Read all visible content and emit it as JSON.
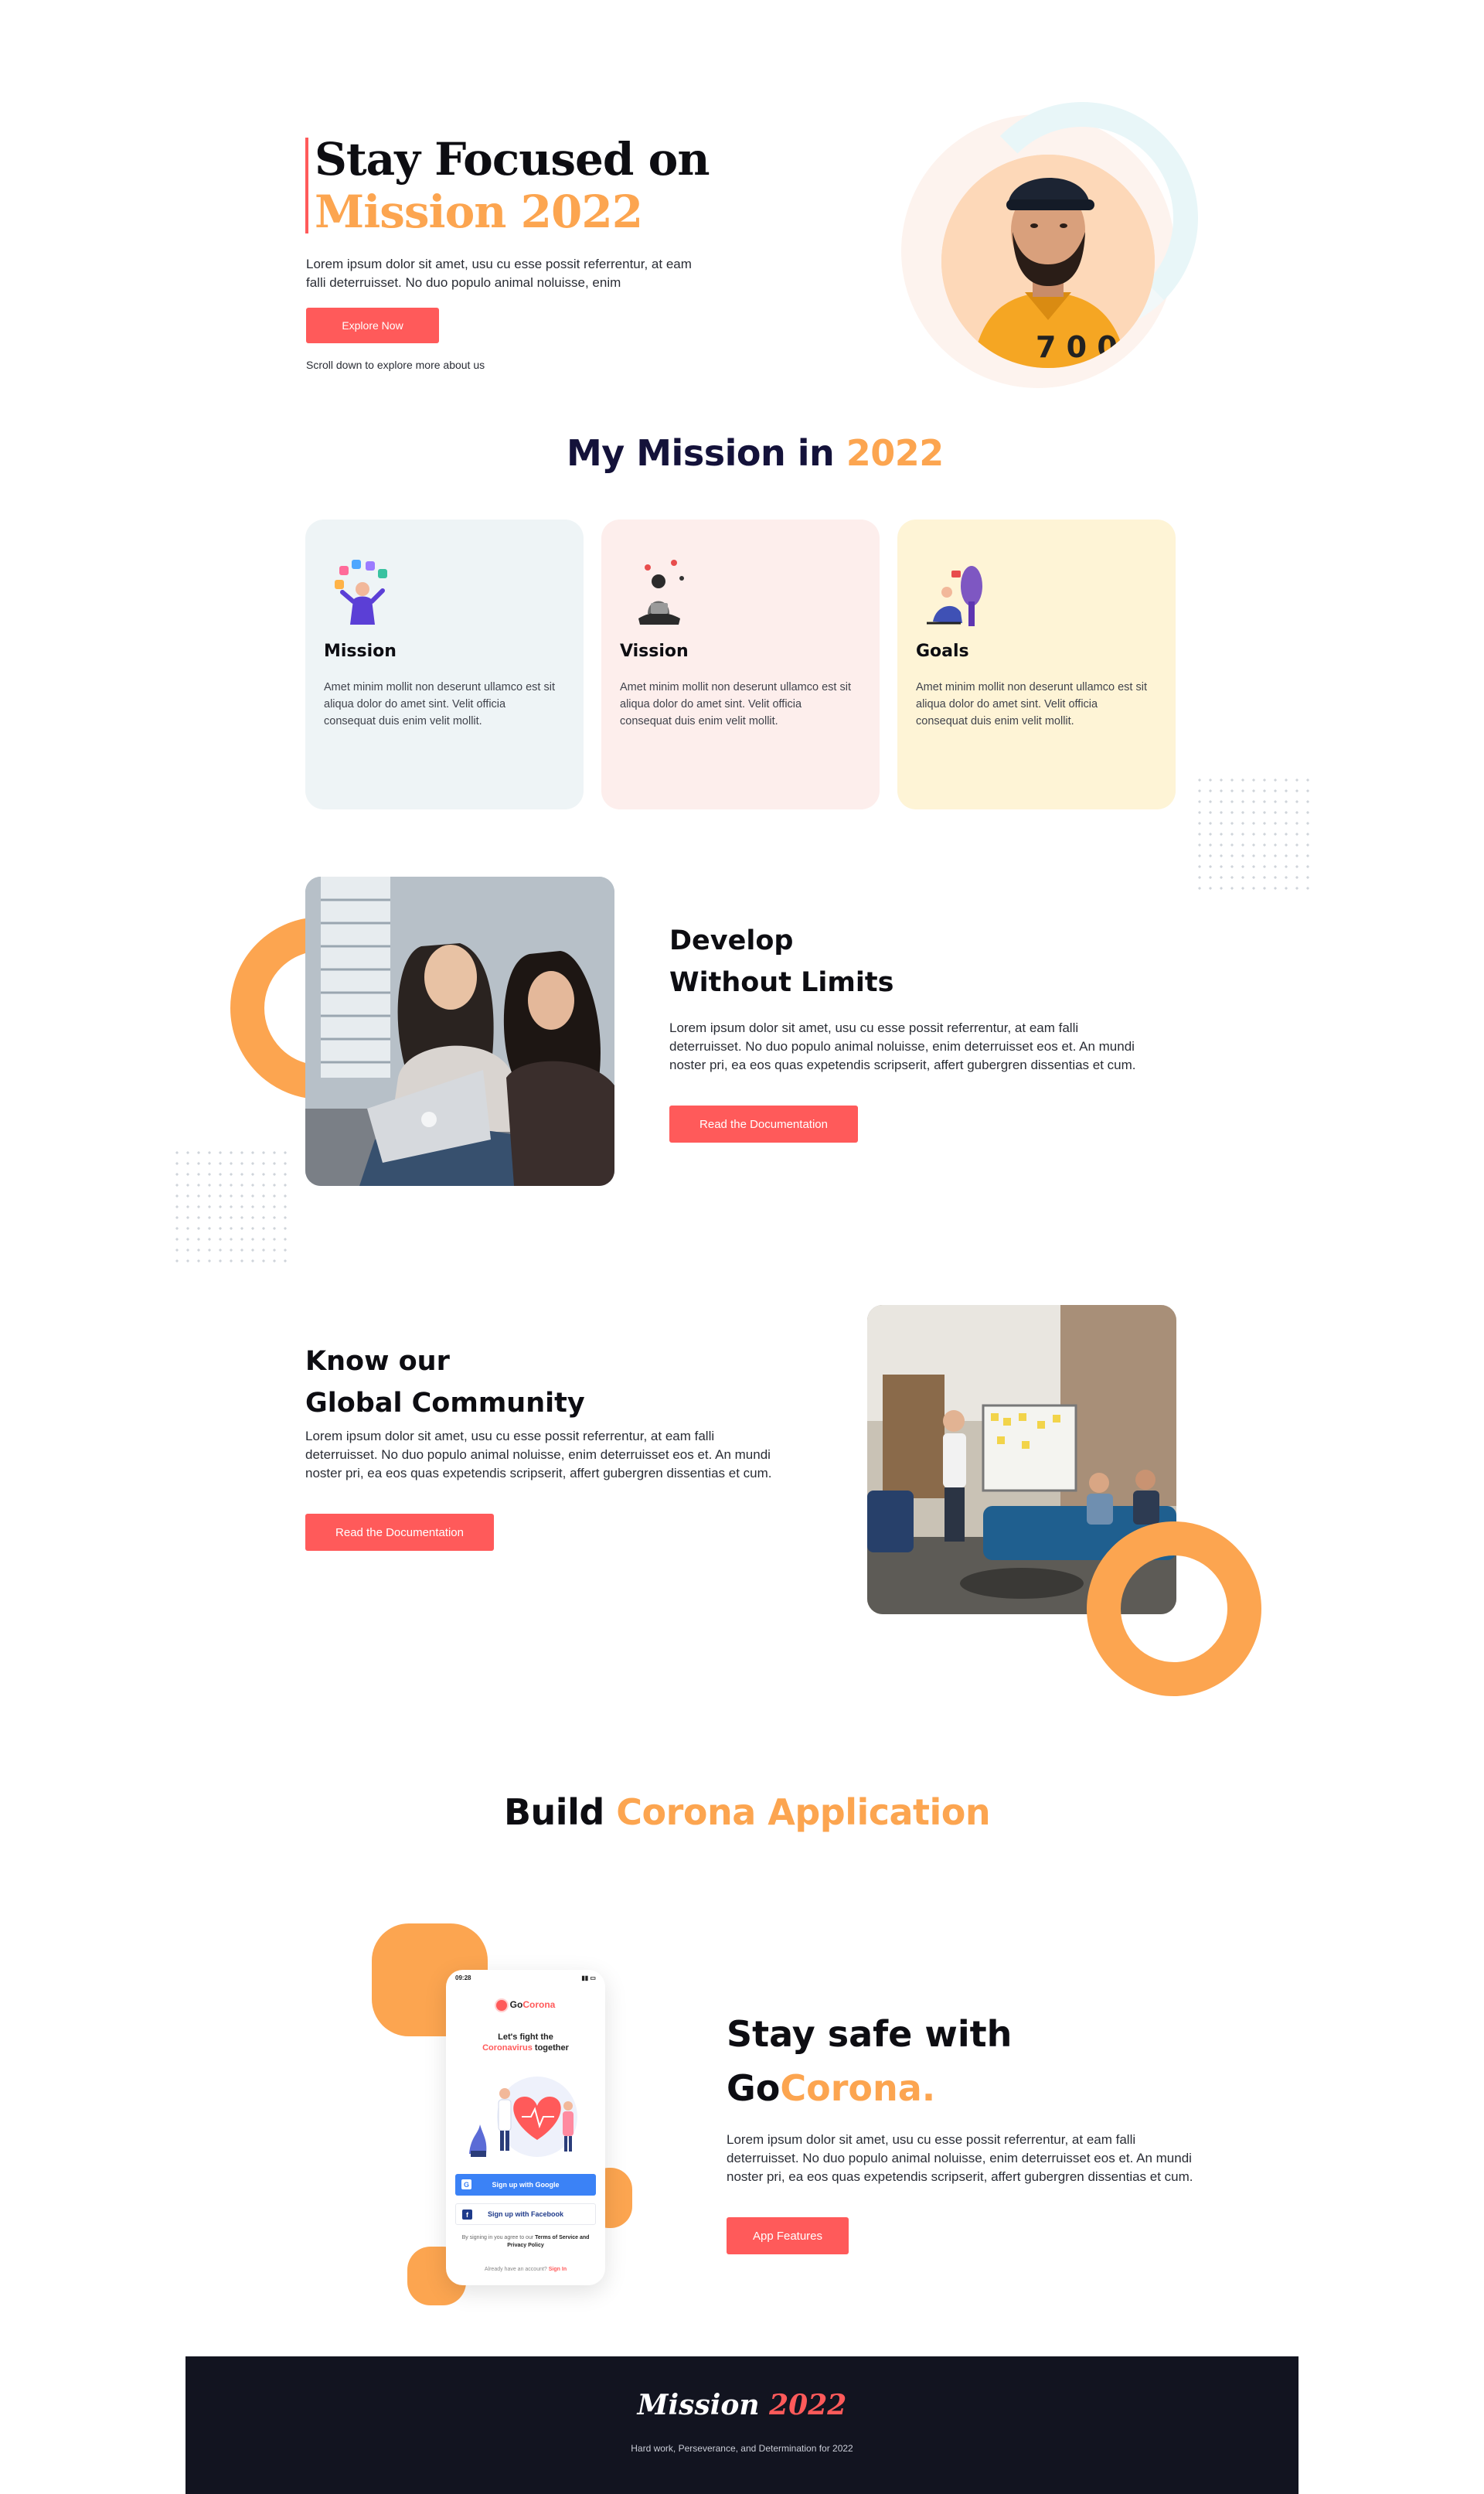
{
  "hero": {
    "title_line1": "Stay Focused on",
    "title_line2": "Mission 2022",
    "paragraph": "Lorem ipsum dolor sit amet, usu cu esse possit referrentur, at eam falli deterruisset. No duo populo animal noluisse, enim",
    "button_label": "Explore Now",
    "scroll_note": "Scroll down to explore more about us"
  },
  "mission": {
    "heading_part1": "My Mission in ",
    "heading_part2": "2022",
    "cards": [
      {
        "title": "Mission",
        "text": "Amet minim mollit non deserunt ullamco est sit aliqua dolor do amet sint. Velit officia consequat duis enim velit mollit."
      },
      {
        "title": "Vission",
        "text": "Amet minim mollit non deserunt ullamco est sit aliqua dolor do amet sint. Velit officia consequat duis enim velit mollit."
      },
      {
        "title": "Goals",
        "text": "Amet minim mollit non deserunt ullamco est sit aliqua dolor do amet sint. Velit officia consequat duis enim velit mollit."
      }
    ]
  },
  "develop": {
    "heading_line1": "Develop",
    "heading_line2": "Without Limits",
    "paragraph": "Lorem ipsum dolor sit amet, usu cu esse possit referrentur, at eam falli deterruisset. No duo populo animal noluisse, enim deterruisset eos et. An mundi noster pri, ea eos quas expetendis scripserit, affert gubergren dissentias et cum.",
    "button_label": "Read the Documentation"
  },
  "community": {
    "heading_line1": "Know our",
    "heading_line2": "Global Community",
    "paragraph": "Lorem ipsum dolor sit amet, usu cu esse possit referrentur, at eam falli deterruisset. No duo populo animal noluisse, enim deterruisset eos et. An mundi noster pri, ea eos quas expetendis scripserit, affert gubergren dissentias et cum.",
    "button_label": "Read the Documentation"
  },
  "corona": {
    "heading_part1": "Build ",
    "heading_part2": "Corona Application",
    "phone": {
      "time": "09:28",
      "brand_part1": "Go",
      "brand_part2": "Corona",
      "tagline_line1": "Let's fight the",
      "tagline_highlight": "Coronavirus",
      "tagline_rest": " together",
      "google_button": "Sign up with Google",
      "facebook_button": "Sign up with Facebook",
      "terms_text": "By signing in you agree to our ",
      "terms_bold": "Terms of Service and Privacy Policy",
      "account_text": "Already have an account? ",
      "sign_in": "Sign In"
    },
    "safe_heading_line1": "Stay safe with",
    "safe_heading_part1": "Go",
    "safe_heading_part2": "Corona.",
    "paragraph": "Lorem ipsum dolor sit amet, usu cu esse possit referrentur, at eam falli deterruisset. No duo populo animal noluisse, enim deterruisset eos et. An mundi noster pri, ea eos quas expetendis scripserit, affert gubergren dissentias et cum.",
    "button_label": "App Features"
  },
  "footer": {
    "logo_part1": "Mission ",
    "logo_part2": "2022",
    "tagline": "Hard work, Perseverance, and Determination for 2022"
  },
  "colors": {
    "accent_orange": "#fca550",
    "accent_red": "#ff5a5a",
    "heading_navy": "#14123a",
    "footer_bg": "#121420",
    "card_mission_bg": "#eef4f6",
    "card_vission_bg": "#fdeeec",
    "card_goals_bg": "#fef4d6"
  }
}
